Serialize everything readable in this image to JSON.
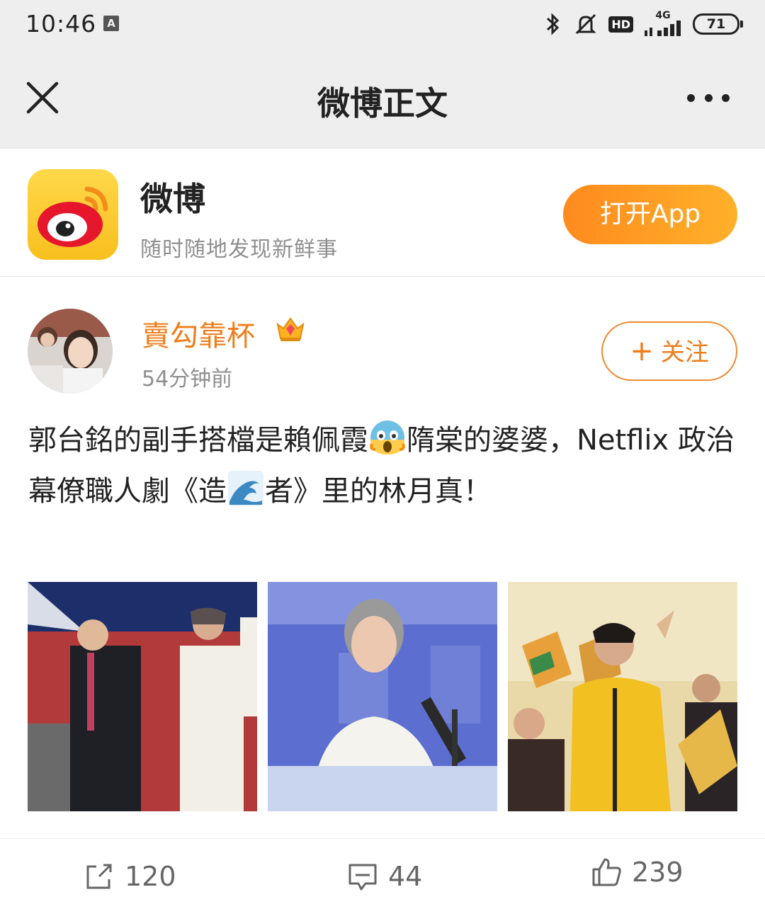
{
  "status_bar": {
    "time": "10:46",
    "network": "4G",
    "hd": "HD",
    "battery": "71"
  },
  "nav": {
    "title": "微博正文",
    "icons": [
      "close-icon",
      "more-icon"
    ]
  },
  "app_banner": {
    "name": "微博",
    "slogan": "随时随地发现新鲜事",
    "open_button": "打开App",
    "accent": "#ff9a26"
  },
  "post": {
    "username": "賣勾靠杯",
    "timestamp": "54分钟前",
    "follow_button": "关注",
    "text_part1": "郭台銘的副手搭檔是賴佩霞",
    "text_part2": "隋棠的婆婆，Netflix 政治幕僚職人劇《造",
    "text_part3": "者》里的林月真！",
    "username_color": "#f07c1a",
    "images": [
      "post-image-1",
      "post-image-2",
      "post-image-3"
    ]
  },
  "actions": {
    "repost_count": "120",
    "comment_count": "44",
    "like_count": "239"
  }
}
